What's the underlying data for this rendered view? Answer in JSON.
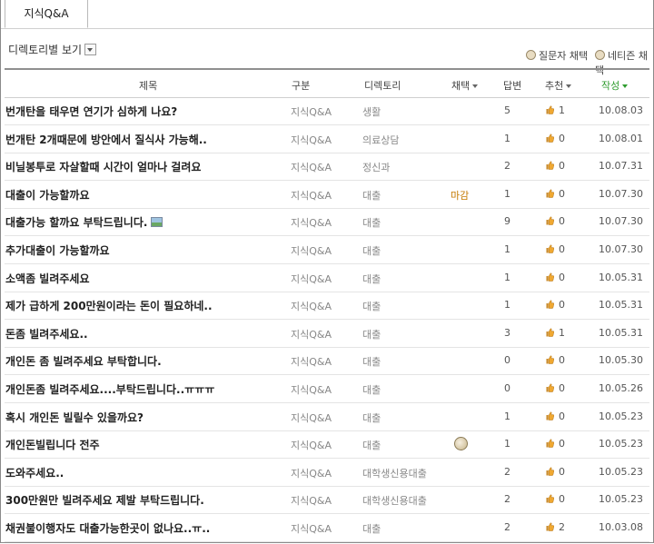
{
  "tabs": [
    {
      "label": "지식Q&A"
    }
  ],
  "view_selector": {
    "label": "디렉토리별 보기"
  },
  "filters": {
    "questioner_pick": "질문자 채택",
    "netizen_pick": "네티즌 채택"
  },
  "columns": {
    "title": "제목",
    "category": "구분",
    "directory": "디렉토리",
    "adopt": "채택",
    "answers": "답변",
    "recommend": "추천",
    "written": "작성"
  },
  "colors": {
    "adopted_text": "#c47a00",
    "active_sort": "#2e9c2e"
  },
  "rows": [
    {
      "title": "번개탄을 태우면 연기가 심하게 나요?",
      "category": "지식Q&A",
      "directory": "생활",
      "adopt": "",
      "answers": "5",
      "recommend": "1",
      "date": "10.08.03"
    },
    {
      "title": "번개탄 2개때문에 방안에서 질식사 가능해..",
      "category": "지식Q&A",
      "directory": "의료상담",
      "adopt": "",
      "answers": "1",
      "recommend": "0",
      "date": "10.08.01"
    },
    {
      "title": "비닐봉투로 자살할때 시간이 얼마나 걸려요",
      "category": "지식Q&A",
      "directory": "정신과",
      "adopt": "",
      "answers": "2",
      "recommend": "0",
      "date": "10.07.31"
    },
    {
      "title": "대출이 가능할까요",
      "category": "지식Q&A",
      "directory": "대출",
      "adopt": "마감",
      "answers": "1",
      "recommend": "0",
      "date": "10.07.30"
    },
    {
      "title": "대출가능 할까요 부탁드립니다.",
      "category": "지식Q&A",
      "directory": "대출",
      "adopt": "",
      "answers": "9",
      "recommend": "0",
      "date": "10.07.30",
      "has_image": true
    },
    {
      "title": "추가대출이 가능할까요",
      "category": "지식Q&A",
      "directory": "대출",
      "adopt": "",
      "answers": "1",
      "recommend": "0",
      "date": "10.07.30"
    },
    {
      "title": "소액좀 빌려주세요",
      "category": "지식Q&A",
      "directory": "대출",
      "adopt": "",
      "answers": "1",
      "recommend": "0",
      "date": "10.05.31"
    },
    {
      "title": "제가 급하게 200만원이라는 돈이 필요하네..",
      "category": "지식Q&A",
      "directory": "대출",
      "adopt": "",
      "answers": "1",
      "recommend": "0",
      "date": "10.05.31"
    },
    {
      "title": "돈좀 빌려주세요..",
      "category": "지식Q&A",
      "directory": "대출",
      "adopt": "",
      "answers": "3",
      "recommend": "1",
      "date": "10.05.31"
    },
    {
      "title": "개인돈 좀 빌려주세요 부탁합니다.",
      "category": "지식Q&A",
      "directory": "대출",
      "adopt": "",
      "answers": "0",
      "recommend": "0",
      "date": "10.05.30"
    },
    {
      "title": "개인돈좀 빌려주세요....부탁드립니다..ㅠㅠㅠ",
      "category": "지식Q&A",
      "directory": "대출",
      "adopt": "",
      "answers": "0",
      "recommend": "0",
      "date": "10.05.26"
    },
    {
      "title": "혹시 개인돈 빌릴수 있을까요?",
      "category": "지식Q&A",
      "directory": "대출",
      "adopt": "",
      "answers": "1",
      "recommend": "0",
      "date": "10.05.23"
    },
    {
      "title": "개인돈빌립니다 전주",
      "category": "지식Q&A",
      "directory": "대출",
      "adopt": "",
      "answers": "1",
      "recommend": "0",
      "date": "10.05.23",
      "medal": true
    },
    {
      "title": "도와주세요..",
      "category": "지식Q&A",
      "directory": "대학생신용대출",
      "adopt": "",
      "answers": "2",
      "recommend": "0",
      "date": "10.05.23"
    },
    {
      "title": "300만원만 빌려주세요 제발 부탁드립니다.",
      "category": "지식Q&A",
      "directory": "대학생신용대출",
      "adopt": "",
      "answers": "2",
      "recommend": "0",
      "date": "10.05.23"
    },
    {
      "title": "채권불이행자도 대출가능한곳이 없나요..ㅠ..",
      "category": "지식Q&A",
      "directory": "대출",
      "adopt": "",
      "answers": "2",
      "recommend": "2",
      "date": "10.03.08"
    }
  ]
}
